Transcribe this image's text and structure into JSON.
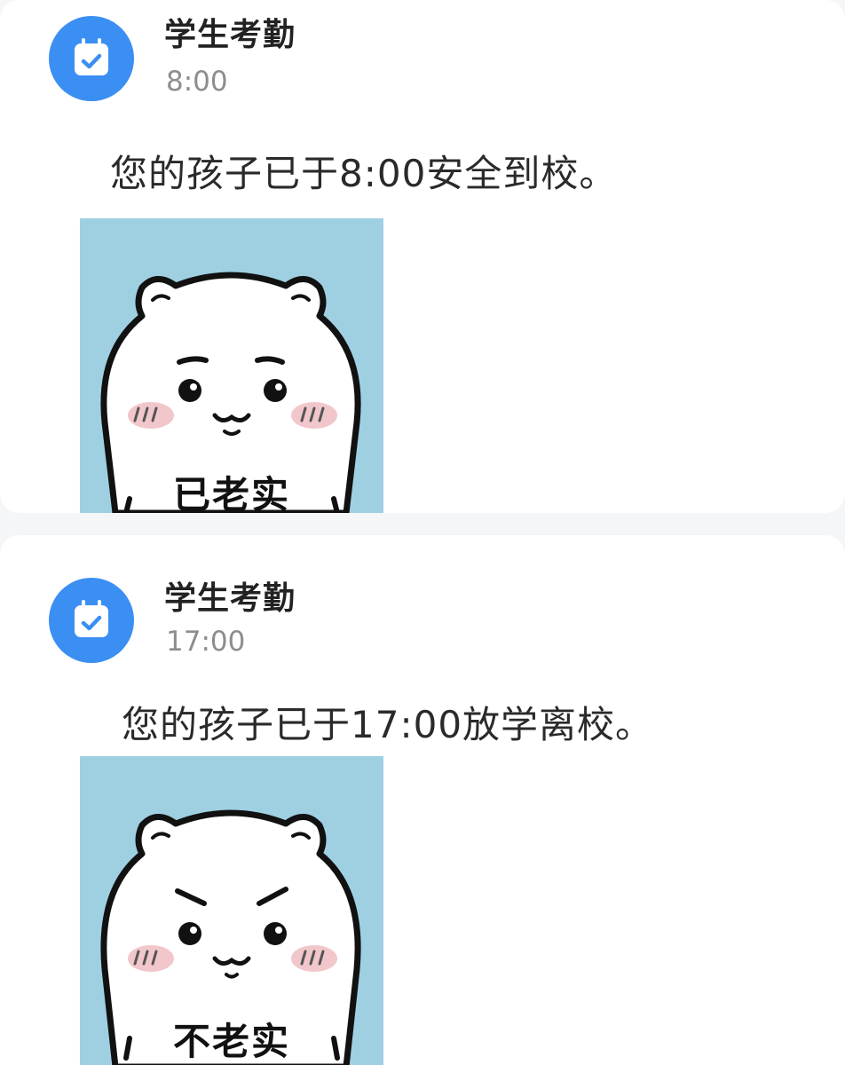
{
  "messages": [
    {
      "sender": "学生考勤",
      "avatar_icon": "calendar-check-icon",
      "time": "8:00",
      "text": "您的孩子已于8:00安全到校。",
      "sticker_caption": "已老实",
      "sticker_mood": "timid"
    },
    {
      "sender": "学生考勤",
      "avatar_icon": "calendar-check-icon",
      "time": "17:00",
      "text": "您的孩子已于17:00放学离校。",
      "sticker_caption": "不老实",
      "sticker_mood": "mischievous"
    }
  ],
  "colors": {
    "avatar_blue": "#3b8ff3",
    "sticker_background": "#9fd0e2",
    "page_background": "#f5f6f8",
    "card_background": "#ffffff"
  }
}
